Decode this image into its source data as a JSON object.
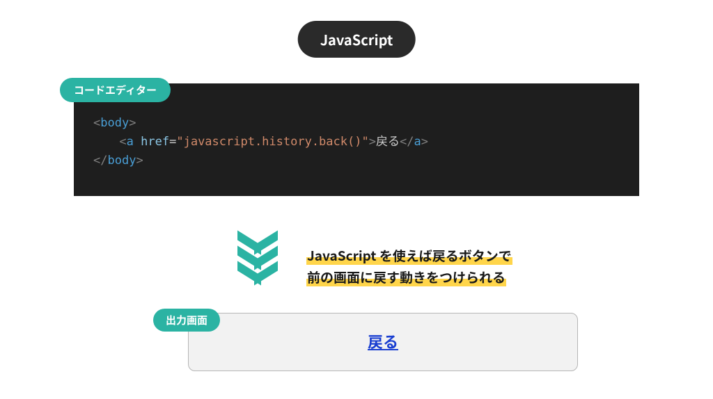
{
  "title": "JavaScript",
  "editor": {
    "badge": "コードエディター",
    "code": {
      "open_tag": "body",
      "link_tag": "a",
      "attr_name": "href",
      "attr_value": "javascript.history.back()",
      "link_text": "戻る",
      "close_tag": "body"
    }
  },
  "annotation": {
    "line1": "JavaScript を使えば戻るボタンで",
    "line2": "前の画面に戻す動きをつけられる"
  },
  "output": {
    "badge": "出力画面",
    "link": "戻る"
  }
}
